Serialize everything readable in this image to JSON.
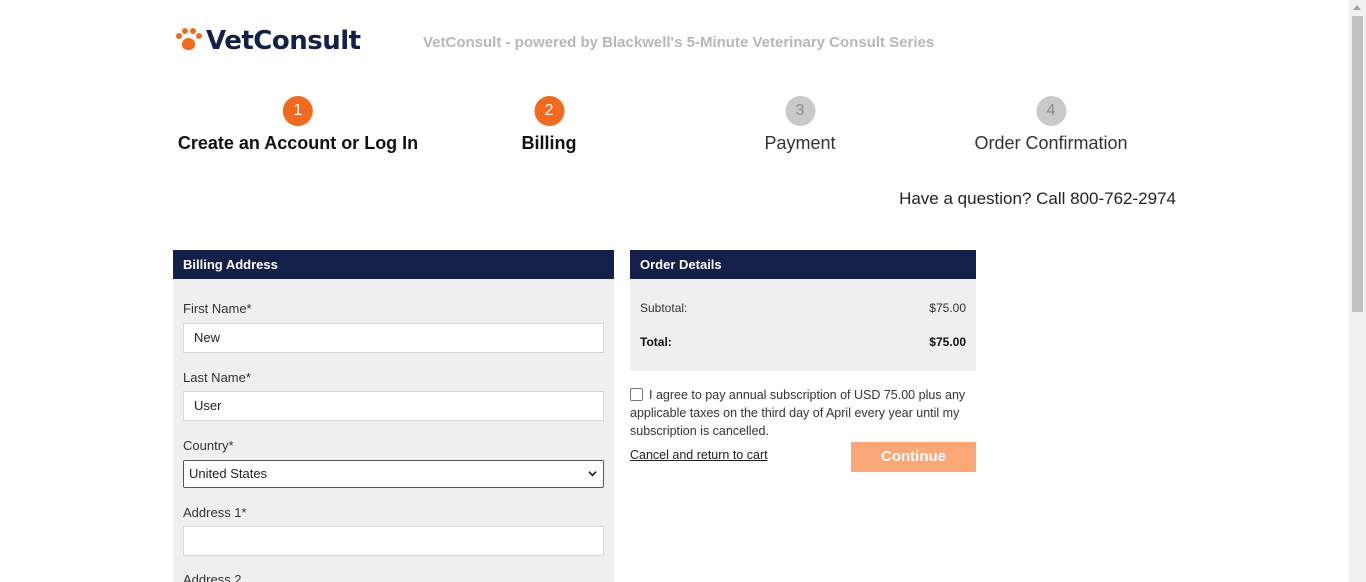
{
  "brand": {
    "name": "VetConsult",
    "tagline": "VetConsult - powered by Blackwell's 5-Minute Veterinary Consult Series",
    "accent_color": "#f26a1e",
    "navy_color": "#141f4a"
  },
  "steps": [
    {
      "number": "1",
      "label": "Create an Account or Log In",
      "state": "complete"
    },
    {
      "number": "2",
      "label": "Billing",
      "state": "current"
    },
    {
      "number": "3",
      "label": "Payment",
      "state": "upcoming"
    },
    {
      "number": "4",
      "label": "Order Confirmation",
      "state": "upcoming"
    }
  ],
  "help": {
    "text": "Have a question? Call 800-762-2974"
  },
  "billing": {
    "header": "Billing Address",
    "first_name_label": "First Name*",
    "first_name_value": "New",
    "last_name_label": "Last Name*",
    "last_name_value": "User",
    "country_label": "Country*",
    "country_value": "United States",
    "address1_label": "Address 1*",
    "address1_value": "",
    "address2_label": "Address 2"
  },
  "order": {
    "header": "Order Details",
    "subtotal_label": "Subtotal:",
    "subtotal_value": "$75.00",
    "total_label": "Total:",
    "total_value": "$75.00",
    "agree_text": "I agree to pay annual subscription of USD 75.00 plus any applicable taxes on the third day of April every year until my subscription is cancelled.",
    "agree_checked": false,
    "cancel_link": "Cancel and return to cart",
    "continue_label": "Continue"
  }
}
